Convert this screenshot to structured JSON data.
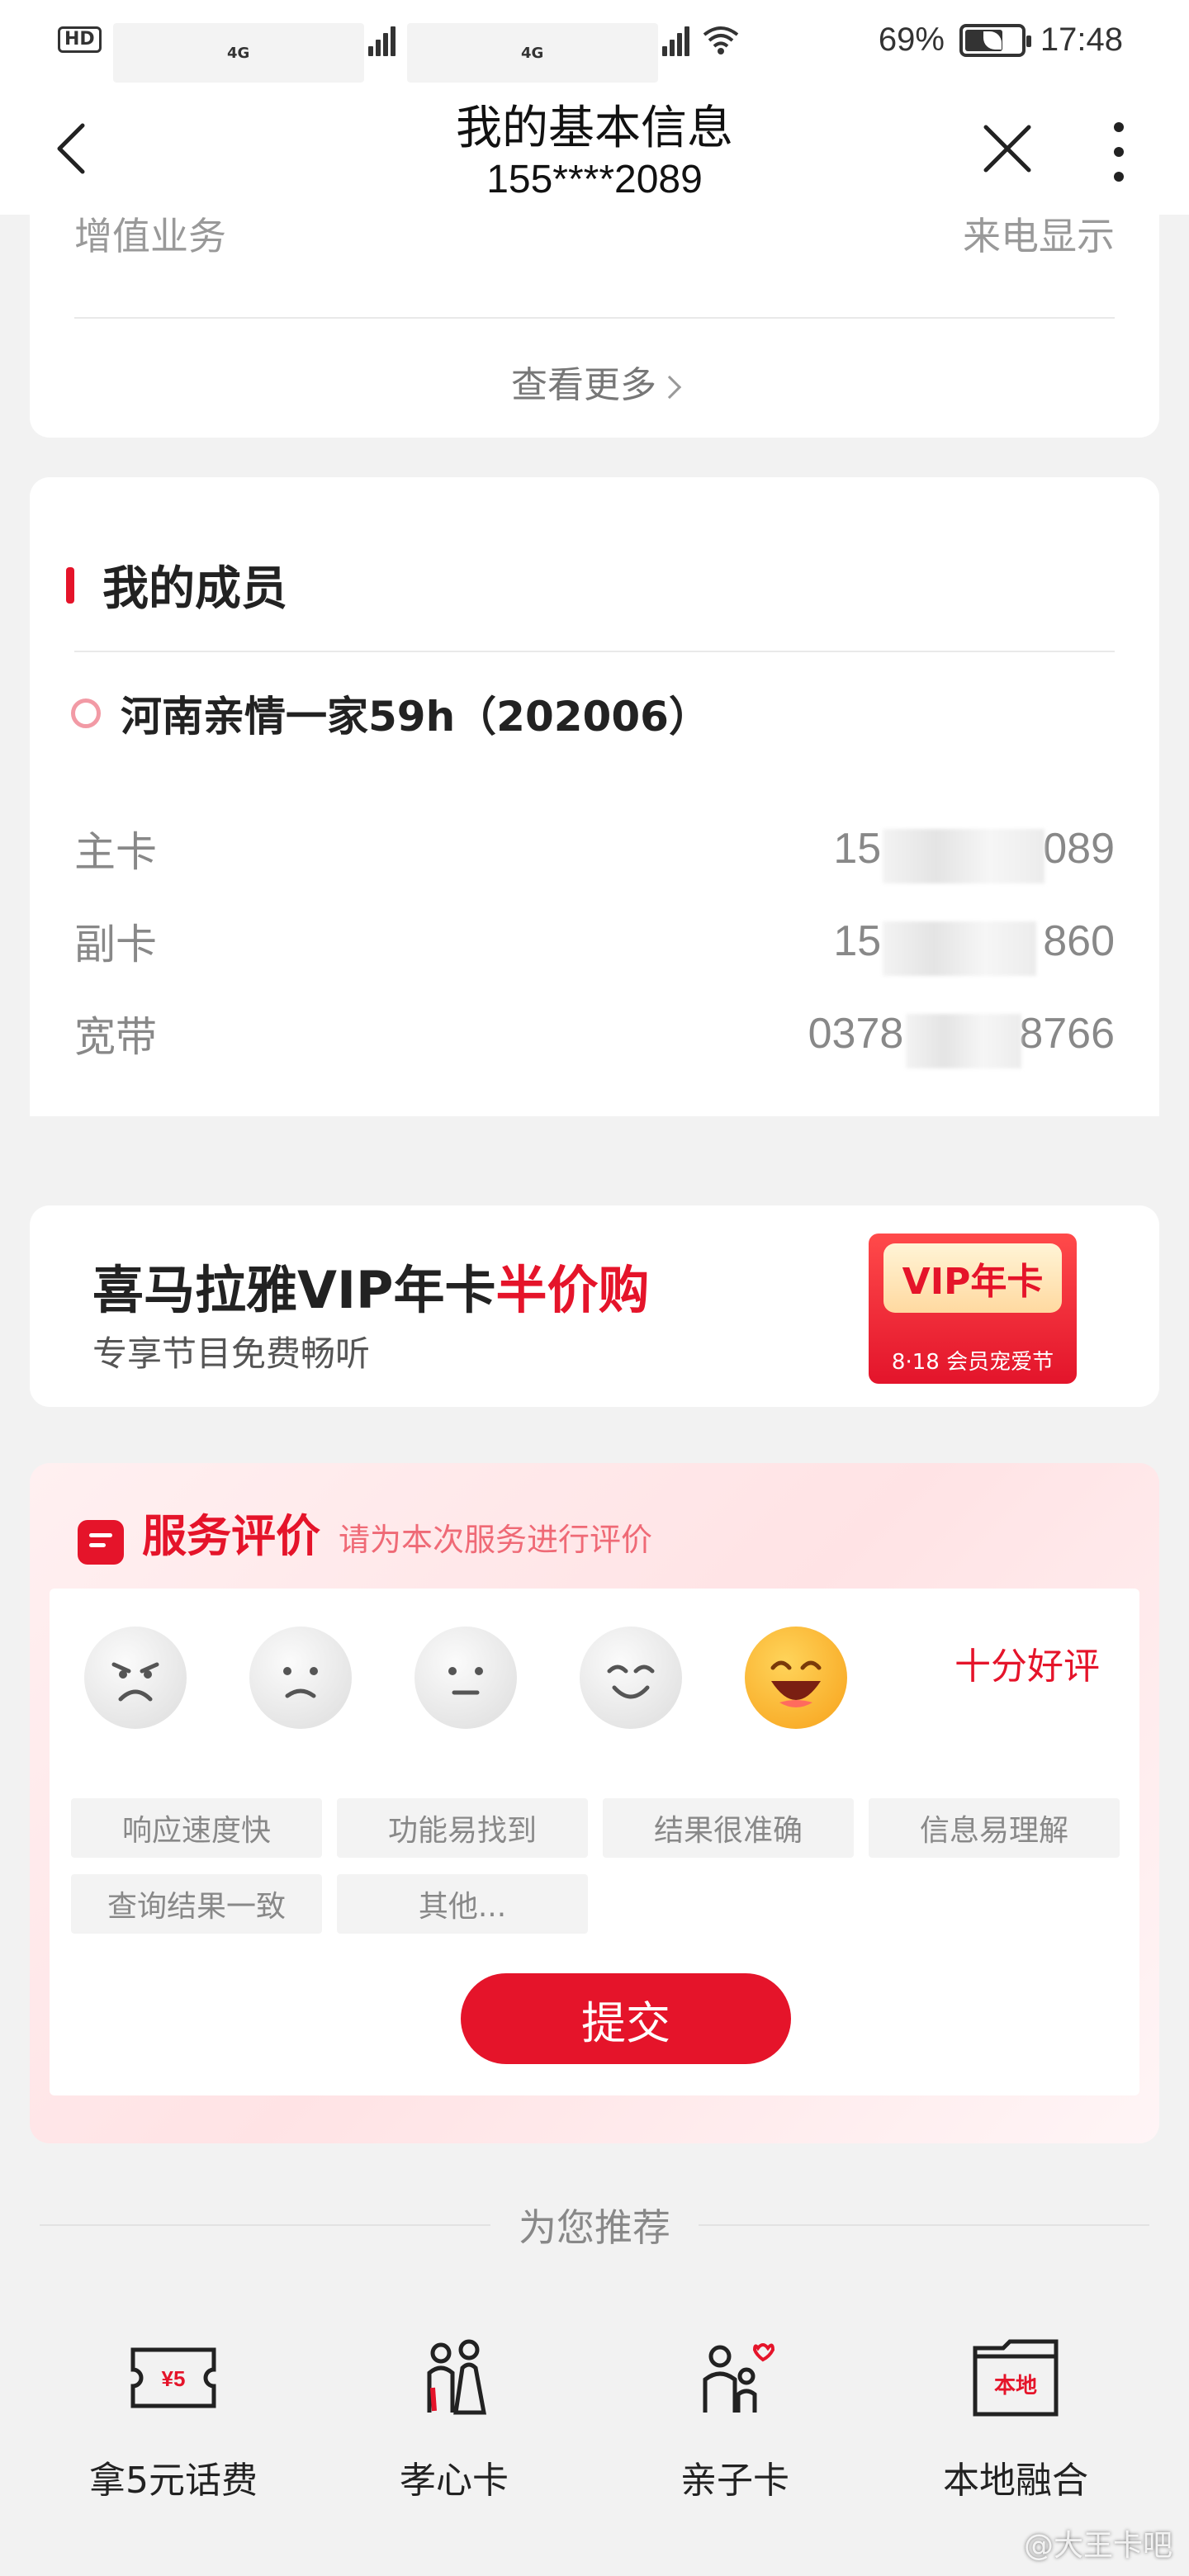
{
  "status_bar": {
    "hd": "HD",
    "net1": "4G",
    "net2": "4G",
    "battery": "69%",
    "battery_level": 0.69,
    "time": "17:48"
  },
  "header": {
    "title": "我的基本信息",
    "subtitle": "155****2089"
  },
  "vas": {
    "label": "增值业务",
    "value": "来电显示",
    "more": "查看更多"
  },
  "members": {
    "title": "我的成员",
    "plan": "河南亲情一家59h（202006）",
    "rows": [
      {
        "label": "主卡",
        "prefix": "15",
        "suffix": "089"
      },
      {
        "label": "副卡",
        "prefix": "15",
        "suffix": "860"
      },
      {
        "label": "宽带",
        "prefix": "0378",
        "suffix": "8766"
      }
    ]
  },
  "banner": {
    "title_main": "喜马拉雅VIP年卡",
    "title_highlight": "半价购",
    "subtitle": "专享节目免费畅听",
    "badge_top": "VIP年卡",
    "badge_bottom": "8·18 会员宠爱节"
  },
  "rating": {
    "title": "服务评价",
    "hint": "请为本次服务进行评价",
    "selected_label": "十分好评",
    "selected_index": 4,
    "tags": [
      "响应速度快",
      "功能易找到",
      "结果很准确",
      "信息易理解",
      "查询结果一致",
      "其他..."
    ],
    "submit": "提交"
  },
  "recommend": {
    "title": "为您推荐",
    "items": [
      {
        "label": "拿5元话费",
        "icon": "coupon-icon",
        "icon_text": "¥5"
      },
      {
        "label": "孝心卡",
        "icon": "elderly-icon"
      },
      {
        "label": "亲子卡",
        "icon": "family-icon"
      },
      {
        "label": "本地融合",
        "icon": "local-icon",
        "icon_text": "本地"
      }
    ]
  },
  "watermark": "@大王卡吧",
  "colors": {
    "accent": "#e5142a",
    "background": "#f2f2f2"
  }
}
